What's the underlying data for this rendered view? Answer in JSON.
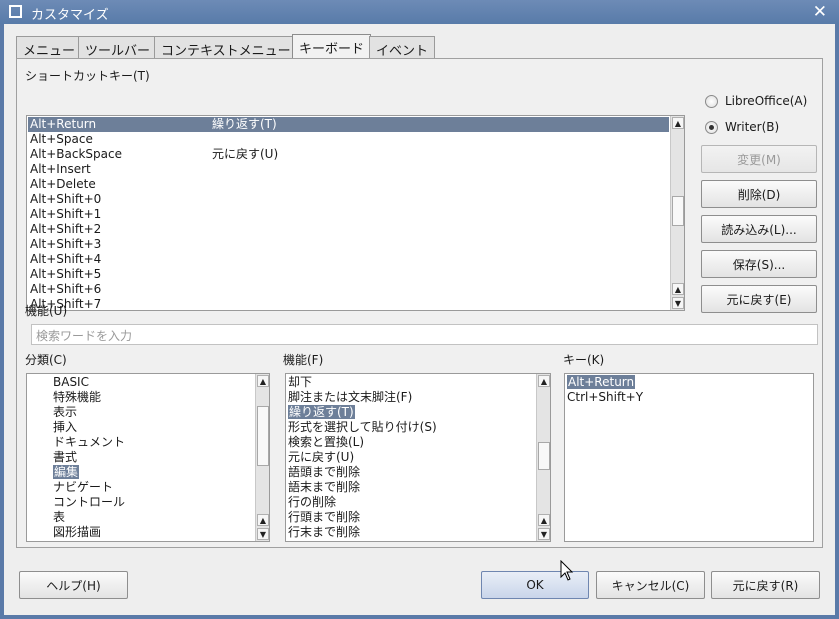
{
  "window": {
    "title": "カスタマイズ"
  },
  "tabs": [
    "メニュー",
    "ツールバー",
    "コンテキストメニュー",
    "キーボード",
    "イベント"
  ],
  "shortcut_label": "ショートカットキー(T)",
  "shortcuts": [
    {
      "key": "Alt+Return",
      "command": "繰り返す(T)"
    },
    {
      "key": "Alt+Space",
      "command": ""
    },
    {
      "key": "Alt+BackSpace",
      "command": "元に戻す(U)"
    },
    {
      "key": "Alt+Insert",
      "command": ""
    },
    {
      "key": "Alt+Delete",
      "command": ""
    },
    {
      "key": "Alt+Shift+0",
      "command": ""
    },
    {
      "key": "Alt+Shift+1",
      "command": ""
    },
    {
      "key": "Alt+Shift+2",
      "command": ""
    },
    {
      "key": "Alt+Shift+3",
      "command": ""
    },
    {
      "key": "Alt+Shift+4",
      "command": ""
    },
    {
      "key": "Alt+Shift+5",
      "command": ""
    },
    {
      "key": "Alt+Shift+6",
      "command": ""
    },
    {
      "key": "Alt+Shift+7",
      "command": ""
    }
  ],
  "scope": {
    "libreoffice": "LibreOffice(A)",
    "writer": "Writer(B)"
  },
  "side_buttons": {
    "modify": "変更(M)",
    "delete": "削除(D)",
    "load": "読み込み(L)...",
    "save": "保存(S)...",
    "reset": "元に戻す(E)"
  },
  "function_label": "機能(U)",
  "search_placeholder": "検索ワードを入力",
  "category": {
    "label": "分類(C)",
    "items": [
      "BASIC",
      "特殊機能",
      "表示",
      "挿入",
      "ドキュメント",
      "書式",
      "編集",
      "ナビゲート",
      "コントロール",
      "表",
      "図形描画"
    ],
    "selected": "編集"
  },
  "functions": {
    "label": "機能(F)",
    "items": [
      "却下",
      "脚注または文末脚注(F)",
      "繰り返す(T)",
      "形式を選択して貼り付け(S)",
      "検索と置換(L)",
      "元に戻す(U)",
      "語頭まで削除",
      "語末まで削除",
      "行の削除",
      "行頭まで削除",
      "行末まで削除"
    ],
    "selected": "繰り返す(T)"
  },
  "keys": {
    "label": "キー(K)",
    "items": [
      "Alt+Return",
      "Ctrl+Shift+Y"
    ],
    "selected": "Alt+Return"
  },
  "bottom_buttons": {
    "help": "ヘルプ(H)",
    "ok": "OK",
    "cancel": "キャンセル(C)",
    "reset": "元に戻す(R)"
  }
}
